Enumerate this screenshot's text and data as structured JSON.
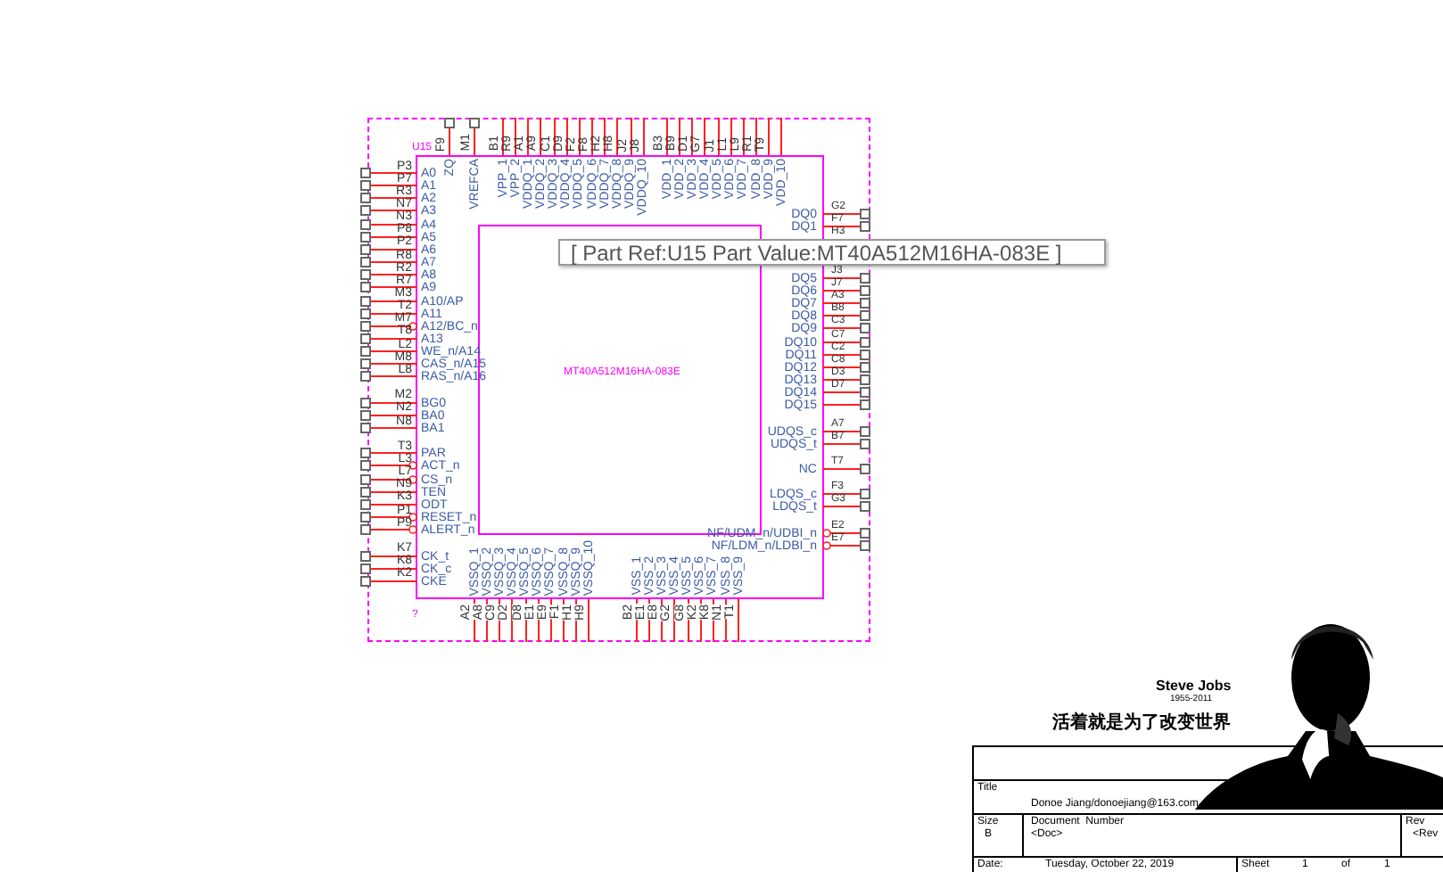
{
  "part": {
    "reference": "U15",
    "value": "MT40A512M16HA-083E",
    "unannotated_mark": "?",
    "left_pin_groups": [
      [
        {
          "pin": "P3",
          "name": "A0",
          "inverted": false
        },
        {
          "pin": "P7",
          "name": "A1",
          "inverted": false
        },
        {
          "pin": "R3",
          "name": "A2",
          "inverted": false
        },
        {
          "pin": "N7",
          "name": "A3",
          "inverted": false
        },
        {
          "pin": "N3",
          "name": "A4",
          "inverted": false
        },
        {
          "pin": "P8",
          "name": "A5",
          "inverted": false
        },
        {
          "pin": "P2",
          "name": "A6",
          "inverted": false
        },
        {
          "pin": "R8",
          "name": "A7",
          "inverted": false
        },
        {
          "pin": "R2",
          "name": "A8",
          "inverted": false
        },
        {
          "pin": "R7",
          "name": "A9",
          "inverted": false
        },
        {
          "pin": "M3",
          "name": "A10/AP",
          "inverted": false
        },
        {
          "pin": "T2",
          "name": "A11",
          "inverted": false
        },
        {
          "pin": "M7",
          "name": "A12/BC_n",
          "inverted": true
        },
        {
          "pin": "T8",
          "name": "A13",
          "inverted": false
        },
        {
          "pin": "L2",
          "name": "WE_n/A14",
          "inverted": false
        },
        {
          "pin": "M8",
          "name": "CAS_n/A15",
          "inverted": false
        },
        {
          "pin": "L8",
          "name": "RAS_n/A16",
          "inverted": false
        }
      ],
      [
        {
          "pin": "M2",
          "name": "BG0",
          "inverted": false
        },
        {
          "pin": "N2",
          "name": "BA0",
          "inverted": false
        },
        {
          "pin": "N8",
          "name": "BA1",
          "inverted": false
        }
      ],
      [
        {
          "pin": "T3",
          "name": "PAR",
          "inverted": false
        },
        {
          "pin": "L3",
          "name": "ACT_n",
          "inverted": true
        },
        {
          "pin": "L7",
          "name": "CS_n",
          "inverted": true
        },
        {
          "pin": "N9",
          "name": "TEN",
          "inverted": false
        },
        {
          "pin": "K3",
          "name": "ODT",
          "inverted": false
        },
        {
          "pin": "P1",
          "name": "RESET_n",
          "inverted": true
        },
        {
          "pin": "P9",
          "name": "ALERT_n",
          "inverted": true
        }
      ],
      [
        {
          "pin": "K7",
          "name": "CK_t",
          "inverted": false
        },
        {
          "pin": "K8",
          "name": "CK_c",
          "inverted": false
        },
        {
          "pin": "K2",
          "name": "CKE",
          "inverted": false
        }
      ]
    ],
    "right_pin_groups": [
      [
        {
          "kind": "pin",
          "pin": "G2",
          "name": "DQ0",
          "inverted": false
        },
        {
          "kind": "pin",
          "pin": "F7",
          "name": "DQ1",
          "inverted": false
        },
        {
          "kind": "covered",
          "pin": "H3"
        },
        {
          "kind": "covered"
        },
        {
          "kind": "covered"
        },
        {
          "kind": "pin",
          "pin": "J3",
          "name": "DQ5",
          "inverted": false
        },
        {
          "kind": "pin",
          "pin": "J7",
          "name": "DQ6",
          "inverted": false
        },
        {
          "kind": "pin",
          "pin": "A3",
          "name": "DQ7",
          "inverted": false
        },
        {
          "kind": "pin",
          "pin": "B8",
          "name": "DQ8",
          "inverted": false
        },
        {
          "kind": "pin",
          "pin": "C3",
          "name": "DQ9",
          "inverted": false
        },
        {
          "kind": "pin",
          "pin": "C7",
          "name": "DQ10",
          "inverted": false
        },
        {
          "kind": "pin",
          "pin": "C2",
          "name": "DQ11",
          "inverted": false
        },
        {
          "kind": "pin",
          "pin": "C8",
          "name": "DQ12",
          "inverted": false
        },
        {
          "kind": "pin",
          "pin": "D3",
          "name": "DQ13",
          "inverted": false
        },
        {
          "kind": "pin",
          "pin": "D7",
          "name": "DQ14",
          "inverted": false
        },
        {
          "kind": "pin",
          "name": "DQ15",
          "inverted": false
        }
      ],
      [
        {
          "kind": "pin",
          "pin": "A7",
          "name": "UDQS_c",
          "inverted": false
        },
        {
          "kind": "pin",
          "pin": "B7",
          "name": "UDQS_t",
          "inverted": false
        }
      ],
      [
        {
          "kind": "pin",
          "pin": "T7",
          "name": "NC",
          "inverted": false
        }
      ],
      [
        {
          "kind": "pin",
          "pin": "F3",
          "name": "LDQS_c",
          "inverted": false
        },
        {
          "kind": "pin",
          "pin": "G3",
          "name": "LDQS_t",
          "inverted": false
        }
      ],
      [
        {
          "kind": "pin",
          "pin": "E2",
          "name": "NF/UDM_n/UDBI_n",
          "inverted": true
        },
        {
          "kind": "pin",
          "pin": "E7",
          "name": "NF/LDM_n/LDBI_n",
          "inverted": true
        }
      ]
    ],
    "top_pin_groups": [
      [
        {
          "pin": "F9",
          "name": "ZQ"
        },
        {
          "pin": "M1",
          "name": "VREFCA"
        }
      ],
      [
        {
          "pin": "B1",
          "name": "VPP_1"
        },
        {
          "pin": "R9",
          "name": "VPP_2"
        },
        {
          "pin": "A1",
          "name": "VDDQ_1"
        },
        {
          "pin": "A9",
          "name": "VDDQ_2"
        },
        {
          "pin": "C1",
          "name": "VDDQ_3"
        },
        {
          "pin": "D9",
          "name": "VDDQ_4"
        },
        {
          "pin": "F2",
          "name": "VDDQ_5"
        },
        {
          "pin": "F8",
          "name": "VDDQ_6"
        },
        {
          "pin": "H2",
          "name": "VDDQ_7"
        },
        {
          "pin": "H8",
          "name": "VDDQ_8"
        },
        {
          "pin": "J2",
          "name": "VDDQ_9"
        },
        {
          "pin": "J8",
          "name": "VDDQ_10"
        }
      ],
      [
        {
          "pin": "B3",
          "name": "VDD_1"
        },
        {
          "pin": "B9",
          "name": "VDD_2"
        },
        {
          "pin": "D1",
          "name": "VDD_3"
        },
        {
          "pin": "G7",
          "name": "VDD_4"
        },
        {
          "pin": "J1",
          "name": "VDD_5"
        },
        {
          "pin": "L1",
          "name": "VDD_6"
        },
        {
          "pin": "L9",
          "name": "VDD_7"
        },
        {
          "pin": "R1",
          "name": "VDD_8"
        },
        {
          "pin": "T9",
          "name": "VDD_9"
        },
        {
          "name": "VDD_10"
        }
      ]
    ],
    "bottom_pin_groups": [
      [
        {
          "pin": "A2",
          "name": "VSSQ_1"
        },
        {
          "pin": "A8",
          "name": "VSSQ_2"
        },
        {
          "pin": "C9",
          "name": "VSSQ_3"
        },
        {
          "pin": "D2",
          "name": "VSSQ_4"
        },
        {
          "pin": "D8",
          "name": "VSSQ_5"
        },
        {
          "pin": "E1",
          "name": "VSSQ_6"
        },
        {
          "pin": "E9",
          "name": "VSSQ_7"
        },
        {
          "pin": "F1",
          "name": "VSSQ_8"
        },
        {
          "pin": "H1",
          "name": "VSSQ_9"
        },
        {
          "pin": "H9",
          "name": "VSSQ_10"
        }
      ],
      [
        {
          "pin": "B2",
          "name": "VSS_1"
        },
        {
          "pin": "E1",
          "name": "VSS_2"
        },
        {
          "pin": "E8",
          "name": "VSS_3"
        },
        {
          "pin": "G2",
          "name": "VSS_4"
        },
        {
          "pin": "G8",
          "name": "VSS_5"
        },
        {
          "pin": "K2",
          "name": "VSS_6"
        },
        {
          "pin": "K8",
          "name": "VSS_7"
        },
        {
          "pin": "N1",
          "name": "VSS_8"
        },
        {
          "pin": "T1",
          "name": "VSS_9"
        }
      ]
    ]
  },
  "tooltip": "[ Part Ref:U15 Part Value:MT40A512M16HA-083E ]",
  "artwork": {
    "caption": "Steve Jobs",
    "years": "1955-2011",
    "motto": "活着就是为了改变世界"
  },
  "title_block": {
    "title_label": "Title",
    "title": "Donoe Jiang/donoejiang@163.com",
    "size_label": "Size",
    "size": "B",
    "document_label": "Document  Number",
    "document": "<Doc>",
    "rev_label": "Rev",
    "rev": "<Rev",
    "date_label": "Date:",
    "date": "Tuesday, October 22, 2019",
    "sheet_label": "Sheet",
    "sheet": "1",
    "of_label": "of",
    "sheet_count": "1"
  }
}
